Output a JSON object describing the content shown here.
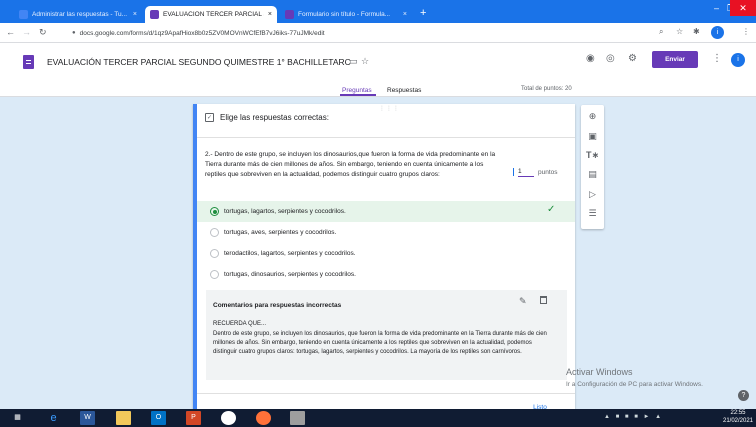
{
  "browser": {
    "tabs": [
      {
        "label": "Administrar las respuestas - Tu...",
        "active": false
      },
      {
        "label": "EVALUACIÓN TERCER PARCIAL S...",
        "active": true
      },
      {
        "label": "Formulario sin título - Formula...",
        "active": false
      }
    ],
    "close_glyph": "×",
    "new_tab_glyph": "+",
    "address": "docs.google.com/forms/d/1qz9ApafHiox8b0z5ZV0MOVnWCfEfB7vJ6iks-77uJMk/edit",
    "profile_initial": "i"
  },
  "form": {
    "title": "EVALUACIÓN TERCER PARCIAL SEGUNDO QUIMESTRE 1° BACHILLETARC",
    "send_label": "Enviar",
    "avatar_initial": "i",
    "tabs": {
      "questions": "Preguntas",
      "responses": "Respuestas"
    },
    "total_points": "Total de puntos: 20"
  },
  "question": {
    "answer_key_label": "Elige las respuestas correctas:",
    "text": "2.- Dentro de este grupo, se incluyen los dinosaurios,que fueron la forma de vida predominante en la Tierra durante más de cien millones de años. Sin embargo, teniendo en cuenta únicamente a los reptiles que sobreviven en la actualidad, podemos distinguir cuatro grupos claros:",
    "points_value": "1",
    "points_label": "puntos",
    "options": [
      {
        "label": "tortugas, lagartos, serpientes y cocodrilos.",
        "correct": true
      },
      {
        "label": "tortugas, aves, serpientes y cocodrilos.",
        "correct": false
      },
      {
        "label": "terodactilos, lagartos, serpientes y cocodrilos.",
        "correct": false
      },
      {
        "label": "tortugas, dinosaurios, serpientes y cocodrilos.",
        "correct": false
      }
    ],
    "feedback": {
      "title": "Comentarios para respuestas incorrectas",
      "heading": "RECUERDA QUE...",
      "body": "Dentro de este grupo, se incluyen los dinosaurios, que fueron la forma de vida predominante en la Tierra durante más de cien millones de años. Sin embargo, teniendo en cuenta únicamente a los reptiles que sobreviven en la actualidad, podemos distinguir cuatro grupos claros: tortugas, lagartos, serpientes y cocodrilos. La mayoría de los reptiles son carnívoros."
    },
    "done_label": "Listo"
  },
  "system": {
    "watermark_title": "Activar Windows",
    "watermark_sub": "Ir a Configuración de PC para activar Windows.",
    "clock_time": "22:55",
    "clock_date": "21/02/2021"
  },
  "colors": {
    "accent": "#673ab7",
    "tabstrip": "#1a73e8",
    "correct": "#1e8e3e",
    "correct_bg": "#e6f4ea",
    "taskbar": "#101c33"
  }
}
